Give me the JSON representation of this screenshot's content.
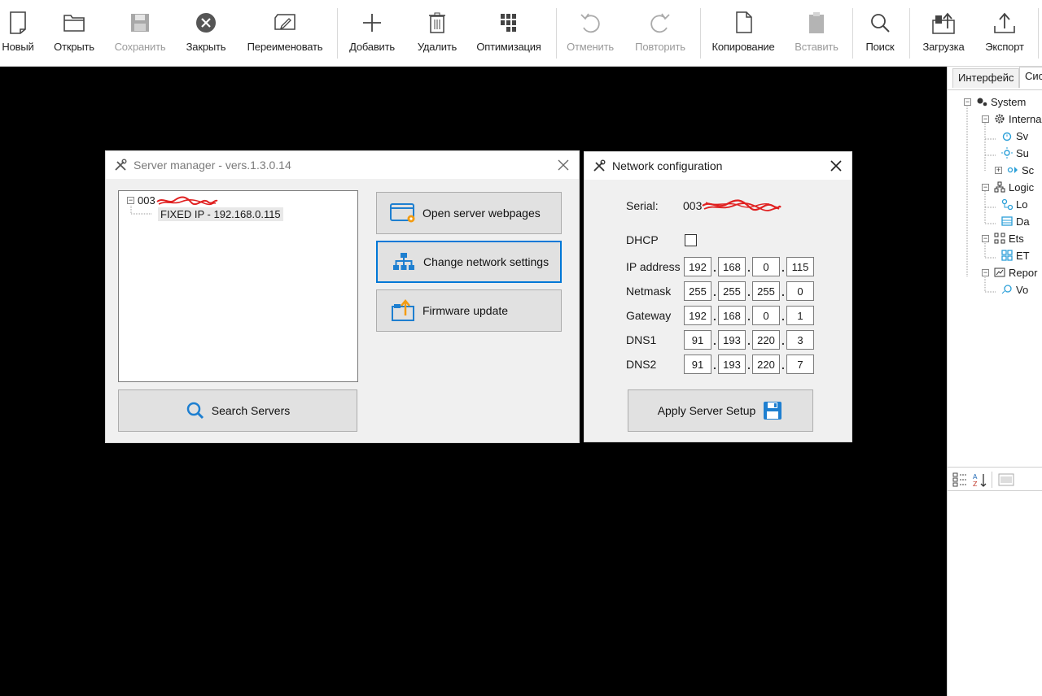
{
  "toolbar": {
    "buttons": [
      {
        "label": "Новый",
        "icon": "new-document-icon",
        "enabled": true
      },
      {
        "label": "Открыть",
        "icon": "open-folder-icon",
        "enabled": true
      },
      {
        "label": "Сохранить",
        "icon": "save-icon",
        "enabled": false
      },
      {
        "label": "Закрыть",
        "icon": "close-circle-icon",
        "enabled": true
      },
      {
        "label": "Переименовать",
        "icon": "rename-icon",
        "enabled": true
      },
      {
        "label": "Добавить",
        "icon": "plus-icon",
        "enabled": true
      },
      {
        "label": "Удалить",
        "icon": "trash-icon",
        "enabled": true
      },
      {
        "label": "Оптимизация",
        "icon": "optimize-icon",
        "enabled": true
      },
      {
        "label": "Отменить",
        "icon": "undo-icon",
        "enabled": false
      },
      {
        "label": "Повторить",
        "icon": "redo-icon",
        "enabled": false
      },
      {
        "label": "Копирование",
        "icon": "copy-icon",
        "enabled": true
      },
      {
        "label": "Вставить",
        "icon": "paste-icon",
        "enabled": false
      },
      {
        "label": "Поиск",
        "icon": "search-icon",
        "enabled": true
      },
      {
        "label": "Загрузка",
        "icon": "upload-icon",
        "enabled": true
      },
      {
        "label": "Экспорт",
        "icon": "export-icon",
        "enabled": true
      }
    ]
  },
  "right_panel": {
    "tabs": [
      "Интерфейс",
      "Сис"
    ],
    "tree": [
      {
        "label": "System",
        "icon": "gears-icon"
      },
      {
        "label": "Interna",
        "icon": "gear-icon"
      },
      {
        "label": "Sv",
        "icon": "alarm-icon"
      },
      {
        "label": "Su",
        "icon": "sun-icon"
      },
      {
        "label": "Sc",
        "icon": "scene-icon"
      },
      {
        "label": "Logic",
        "icon": "logic-icon"
      },
      {
        "label": "Lo",
        "icon": "node-icon"
      },
      {
        "label": "Da",
        "icon": "table-icon"
      },
      {
        "label": "Ets",
        "icon": "ets-icon"
      },
      {
        "label": "ET",
        "icon": "ets-item-icon"
      },
      {
        "label": "Repor",
        "icon": "report-icon"
      },
      {
        "label": "Vo",
        "icon": "value-icon"
      }
    ]
  },
  "server_manager": {
    "title": "Server manager - vers.1.3.0.14",
    "tree_root_prefix": "003",
    "tree_child": "FIXED IP - 192.168.0.115",
    "buttons": {
      "open_webpages": "Open server webpages",
      "change_network": "Change network settings",
      "firmware_update": "Firmware update",
      "search_servers": "Search Servers"
    }
  },
  "network_config": {
    "title": "Network configuration",
    "serial_label": "Serial:",
    "serial_prefix": "003",
    "dhcp_label": "DHCP",
    "dhcp_checked": false,
    "fields": [
      {
        "label": "IP address",
        "octets": [
          "192",
          "168",
          "0",
          "115"
        ]
      },
      {
        "label": "Netmask",
        "octets": [
          "255",
          "255",
          "255",
          "0"
        ]
      },
      {
        "label": "Gateway",
        "octets": [
          "192",
          "168",
          "0",
          "1"
        ]
      },
      {
        "label": "DNS1",
        "octets": [
          "91",
          "193",
          "220",
          "3"
        ]
      },
      {
        "label": "DNS2",
        "octets": [
          "91",
          "193",
          "220",
          "7"
        ]
      }
    ],
    "apply_button": "Apply Server Setup"
  },
  "colors": {
    "accent_blue": "#0078d7",
    "orange": "#f39c12",
    "redaction_red": "#e02020"
  }
}
